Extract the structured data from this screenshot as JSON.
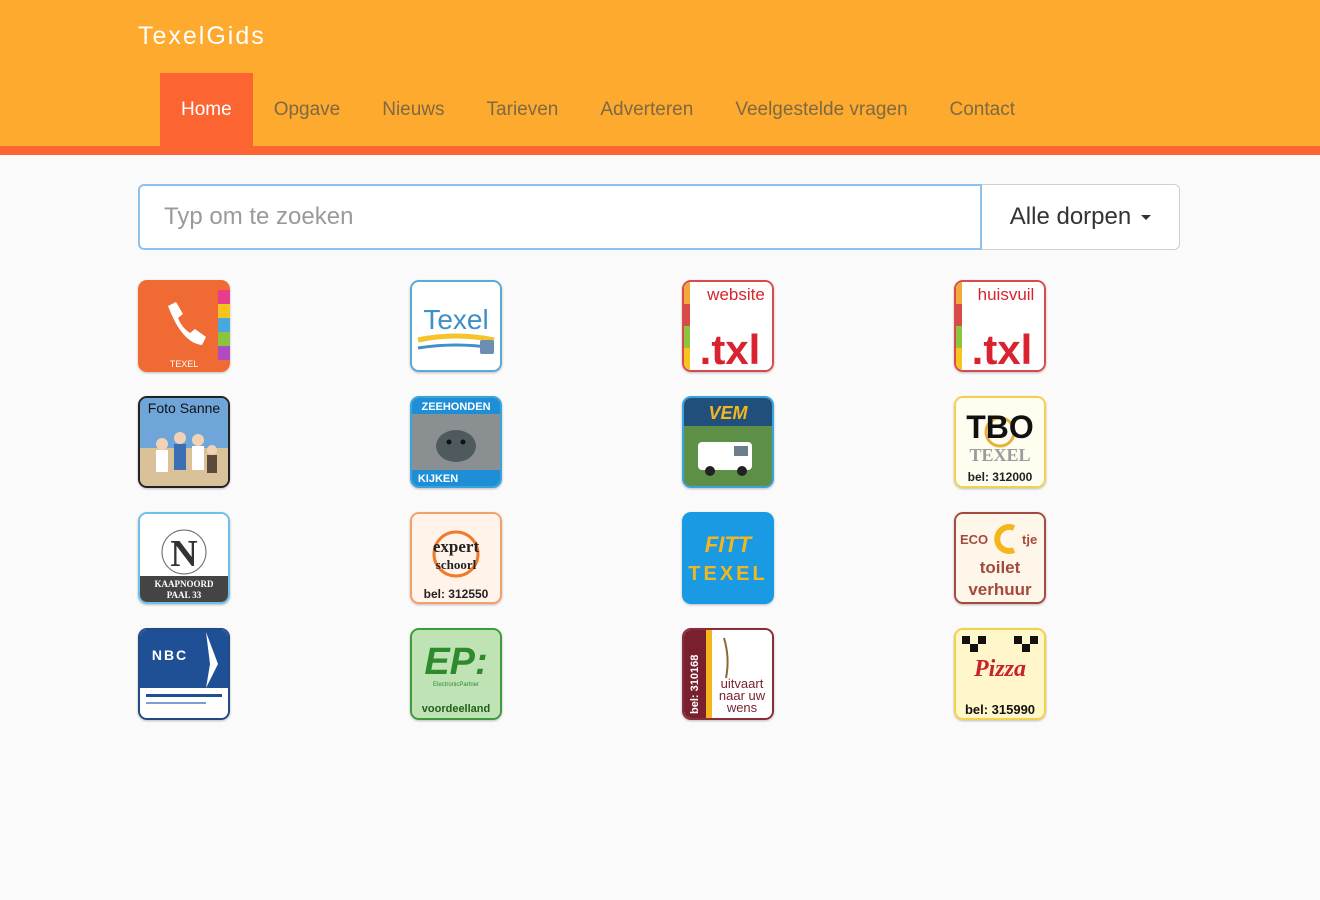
{
  "header": {
    "brand": "TexelGids",
    "nav": [
      {
        "label": "Home",
        "active": true
      },
      {
        "label": "Opgave"
      },
      {
        "label": "Nieuws"
      },
      {
        "label": "Tarieven"
      },
      {
        "label": "Adverteren"
      },
      {
        "label": "Veelgestelde vragen"
      },
      {
        "label": "Contact"
      }
    ]
  },
  "search": {
    "placeholder": "Typ om te zoeken",
    "value": "",
    "village_filter": "Alle dorpen"
  },
  "tiles": [
    {
      "name": "phone-texel",
      "icon": "phone-icon",
      "text": "TEXEL"
    },
    {
      "name": "texel-info",
      "text": "Texel"
    },
    {
      "name": "website-txl",
      "top": "website",
      "main": ".txl"
    },
    {
      "name": "huisvuil-txl",
      "top": "huisvuil",
      "main": ".txl"
    },
    {
      "name": "foto-sanne",
      "text": "Foto Sanne"
    },
    {
      "name": "zeehonden-kijken",
      "top": "ZEEHONDEN",
      "bottom": "KIJKEN"
    },
    {
      "name": "vem",
      "text": "VEM"
    },
    {
      "name": "tbo-texel",
      "main": "TBO",
      "sub": "TEXEL",
      "phone": "bel: 312000"
    },
    {
      "name": "kaapnoord",
      "letter": "N",
      "line1": "KAAPNOORD",
      "line2": "PAAL 33"
    },
    {
      "name": "expert-schoorl",
      "line1": "expert",
      "line2": "schoorl",
      "phone": "bel: 312550"
    },
    {
      "name": "fitt-texel",
      "main": "FITT",
      "sub": "TEXEL"
    },
    {
      "name": "eco-tje",
      "main": "ECO",
      "suffix": "tje",
      "line1": "toilet",
      "line2": "verhuur"
    },
    {
      "name": "nbc",
      "text": "NBC"
    },
    {
      "name": "ep-voordeelland",
      "main": "EP:",
      "small": "ElectronicPartner",
      "bottom": "voordeelland"
    },
    {
      "name": "uitvaart",
      "phone": "bel: 310168",
      "line1": "uitvaart",
      "line2": "naar uw",
      "line3": "wens"
    },
    {
      "name": "pizza",
      "main": "Pizza",
      "phone": "bel: 315990"
    }
  ],
  "colors": {
    "header": "#fdaa2f",
    "accent": "#fc6532",
    "input_border": "#8fc1ea"
  }
}
